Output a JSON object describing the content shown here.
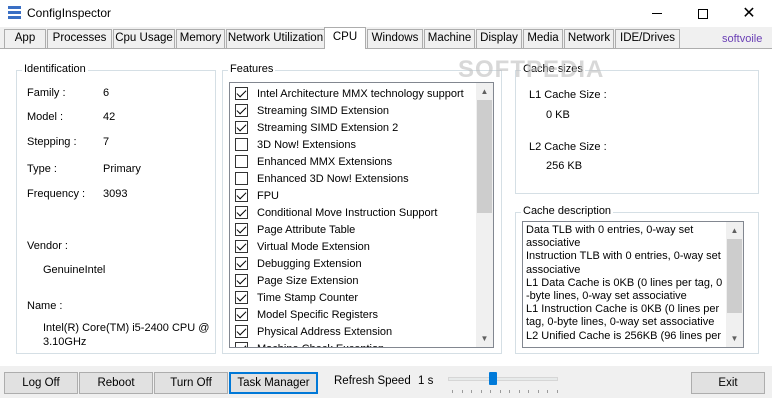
{
  "window": {
    "title": "ConfigInspector",
    "close_glyph": "✕"
  },
  "tabs": [
    "App",
    "Processes",
    "Cpu Usage",
    "Memory",
    "Network Utilization",
    "CPU",
    "Windows",
    "Machine",
    "Display",
    "Media",
    "Network",
    "IDE/Drives"
  ],
  "active_tab": "CPU",
  "brand_link": "softvoile",
  "watermark": "SOFTPEDIA",
  "identification": {
    "title": "Identification",
    "family_label": "Family :",
    "family_value": "6",
    "model_label": "Model :",
    "model_value": "42",
    "stepping_label": "Stepping :",
    "stepping_value": "7",
    "type_label": "Type :",
    "type_value": "Primary",
    "frequency_label": "Frequency :",
    "frequency_value": "3093",
    "vendor_label": "Vendor  :",
    "vendor_value": "GenuineIntel",
    "name_label": "Name :",
    "name_value_line1": "Intel(R) Core(TM) i5-2400 CPU @",
    "name_value_line2": "3.10GHz"
  },
  "features": {
    "title": "Features",
    "items": [
      {
        "label": "Intel Architecture MMX technology support",
        "checked": true
      },
      {
        "label": "Streaming SIMD Extension",
        "checked": true
      },
      {
        "label": "Streaming SIMD Extension 2",
        "checked": true
      },
      {
        "label": "3D Now! Extensions",
        "checked": false
      },
      {
        "label": "Enhanced MMX Extensions",
        "checked": false
      },
      {
        "label": "Enhanced 3D Now! Extensions",
        "checked": false
      },
      {
        "label": "FPU",
        "checked": true
      },
      {
        "label": "Conditional Move Instruction Support",
        "checked": true
      },
      {
        "label": "Page Attribute Table",
        "checked": true
      },
      {
        "label": "Virtual Mode Extension",
        "checked": true
      },
      {
        "label": "Debugging Extension",
        "checked": true
      },
      {
        "label": "Page Size Extension",
        "checked": true
      },
      {
        "label": "Time Stamp Counter",
        "checked": true
      },
      {
        "label": "Model Specific Registers",
        "checked": true
      },
      {
        "label": "Physical Address Extension",
        "checked": true
      },
      {
        "label": "Machine Check Exception",
        "checked": true
      }
    ]
  },
  "cache_sizes": {
    "title": "Cache sizes",
    "l1_label": "L1 Cache Size :",
    "l1_value": "0 KB",
    "l2_label": "L2 Cache Size :",
    "l2_value": "256 KB"
  },
  "cache_description": {
    "title": "Cache description",
    "lines": [
      "Data TLB with    0 entries, 0-way set",
      "associative",
      "Instruction TLB with    0 entries, 0-way set",
      "associative",
      "L1 Data Cache is    0KB (0 lines per tag, 0",
      "-byte lines, 0-way set associative",
      "L1 Instruction Cache is    0KB (0 lines per",
      "tag, 0-byte lines, 0-way set associative",
      "L2 Unified Cache is 256KB (96 lines per"
    ]
  },
  "buttons": {
    "logoff": "Log Off",
    "reboot": "Reboot",
    "turnoff": "Turn Off",
    "task_manager": "Task Manager",
    "exit": "Exit"
  },
  "refresh": {
    "label": "Refresh Speed",
    "value": "1 s",
    "slider_fraction": 0.4
  },
  "colors": {
    "brand_link": "#6a3fb5",
    "focus": "#0078d7",
    "slider_thumb": "#007ad9"
  }
}
